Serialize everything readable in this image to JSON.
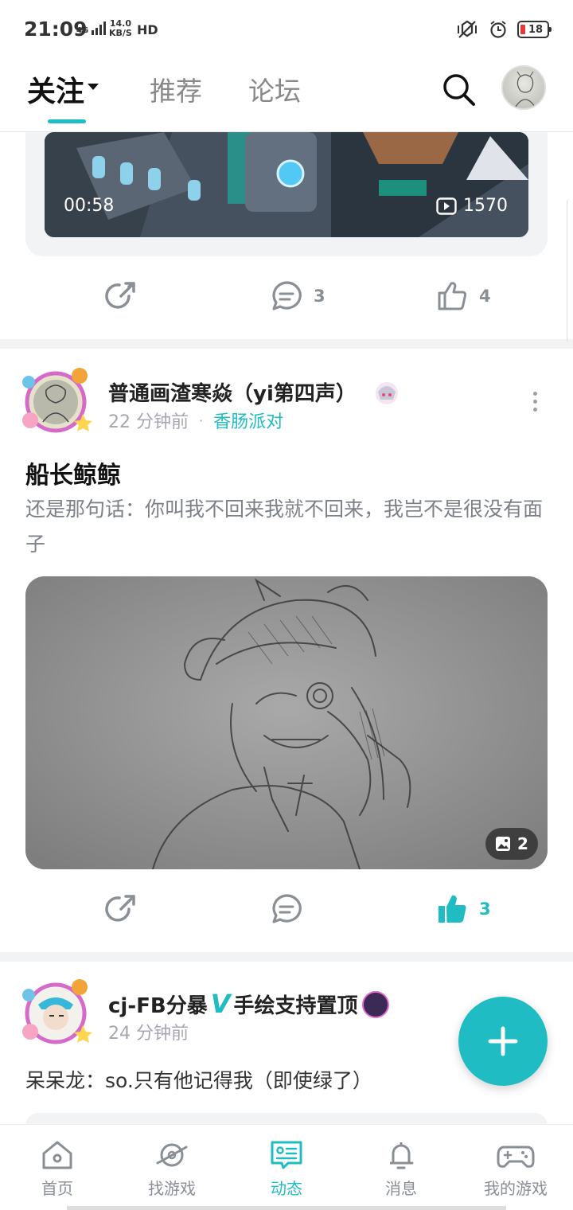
{
  "status": {
    "time": "21:09",
    "net": "4G",
    "speed_top": "14.0",
    "speed_bottom": "KB/S",
    "hd": "HD",
    "battery": "18",
    "battery_color": "#e53935"
  },
  "topnav": {
    "tabs": [
      {
        "label": "关注",
        "active": true
      },
      {
        "label": "推荐",
        "active": false
      },
      {
        "label": "论坛",
        "active": false
      }
    ]
  },
  "accent": "#1fbdc3",
  "video": {
    "duration": "00:58",
    "plays": "1570"
  },
  "post1_actions": {
    "comments": "3",
    "likes": "4"
  },
  "post2": {
    "author": "普通画渣寒焱（yi第四声）",
    "time": "22 分钟前",
    "dot": "·",
    "forum": "香肠派对",
    "title": "船长鲸鲸",
    "body": "还是那句话：你叫我不回来我就不回来，我岂不是很没有面子",
    "image_count": "2",
    "likes": "3"
  },
  "post3": {
    "author_prefix": "cj-FB分暴",
    "badge": "V",
    "author_suffix": "手绘支持置顶",
    "time": "24 分钟前",
    "body": "呆呆龙：so.只有他记得我（即使绿了）"
  },
  "bottom_nav": [
    {
      "label": "首页",
      "icon": "home-icon",
      "active": false
    },
    {
      "label": "找游戏",
      "icon": "planet-icon",
      "active": false
    },
    {
      "label": "动态",
      "icon": "feed-icon",
      "active": true
    },
    {
      "label": "消息",
      "icon": "bell-icon",
      "active": false
    },
    {
      "label": "我的游戏",
      "icon": "gamepad-icon",
      "active": false
    }
  ]
}
